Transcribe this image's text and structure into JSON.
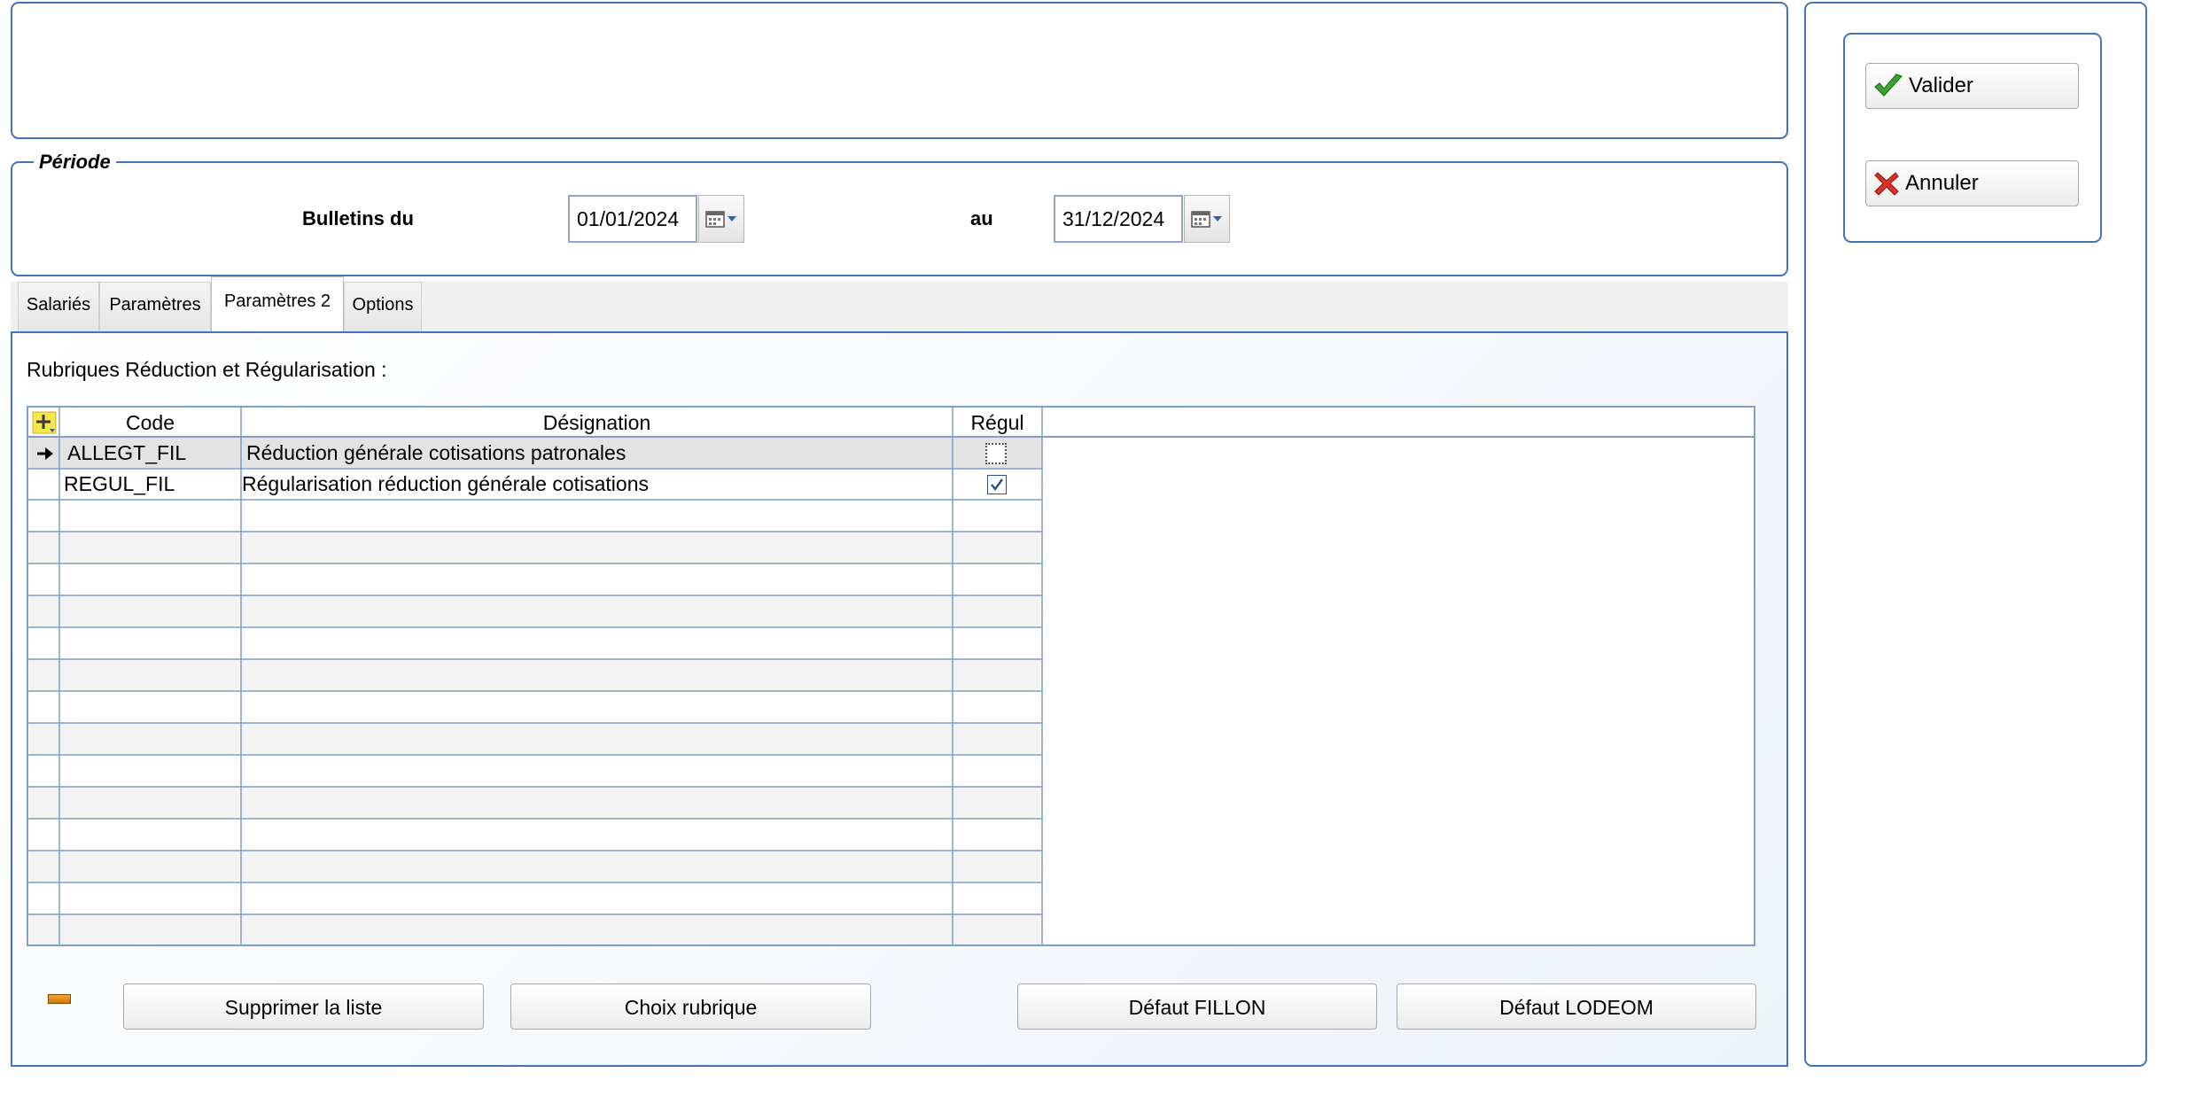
{
  "periode": {
    "legend": "Période",
    "from_label": "Bulletins du",
    "from_value": "01/01/2024",
    "to_label": "au",
    "to_value": "31/12/2024"
  },
  "tabs": [
    {
      "label": "Salariés",
      "active": false
    },
    {
      "label": "Paramètres",
      "active": false
    },
    {
      "label": "Paramètres 2",
      "active": true
    },
    {
      "label": "Options",
      "active": false
    }
  ],
  "section_title": "Rubriques Réduction et Régularisation :",
  "grid": {
    "columns": {
      "code": "Code",
      "designation": "Désignation",
      "regul": "Régul"
    },
    "rows": [
      {
        "code": "ALLEGT_FIL",
        "designation": "Réduction générale cotisations patronales",
        "regul": false,
        "selected": true
      },
      {
        "code": "REGUL_FIL",
        "designation": "Régularisation réduction générale cotisations",
        "regul": true,
        "selected": false
      }
    ]
  },
  "buttons": {
    "supprimer": "Supprimer la liste",
    "choix": "Choix rubrique",
    "fillon": "Défaut FILLON",
    "lodeom": "Défaut LODEOM"
  },
  "actions": {
    "valider": "Valider",
    "annuler": "Annuler"
  },
  "colors": {
    "border_blue": "#3f74b8",
    "grid_line": "#7f9ec9",
    "alt_row": "#f3f3f3",
    "accent_green": "#3aa52c",
    "accent_red": "#d9322b"
  }
}
